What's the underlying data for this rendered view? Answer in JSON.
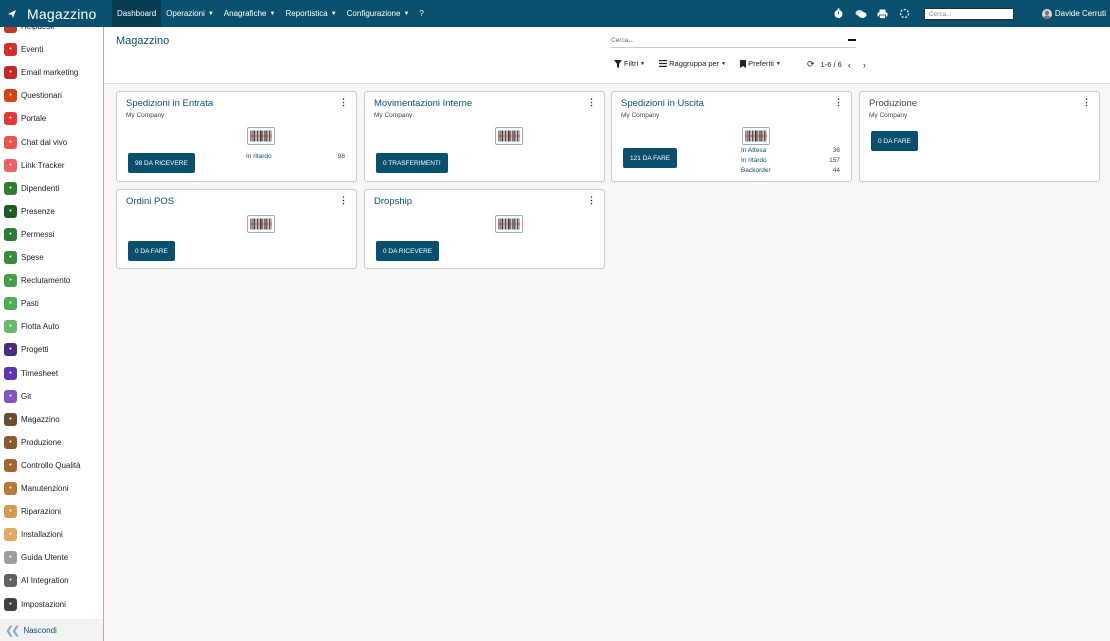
{
  "app": {
    "title": "Magazzino",
    "menu": [
      {
        "label": "Dashboard",
        "active": true,
        "dropdown": false
      },
      {
        "label": "Operazioni",
        "active": false,
        "dropdown": true
      },
      {
        "label": "Anagrafiche",
        "active": false,
        "dropdown": true
      },
      {
        "label": "Reportistica",
        "active": false,
        "dropdown": true
      },
      {
        "label": "Configurazione",
        "active": false,
        "dropdown": true
      },
      {
        "label": "?",
        "active": false,
        "dropdown": false
      }
    ],
    "search_placeholder": "Cerca...",
    "user_name": "Davide Cerruti"
  },
  "sidebar": {
    "items": [
      {
        "label": "Helpdesk",
        "color": "#c0392b",
        "icon": "helpdesk-icon"
      },
      {
        "label": "Eventi",
        "color": "#d32f2f",
        "icon": "events-icon"
      },
      {
        "label": "Email marketing",
        "color": "#c62828",
        "icon": "email-marketing-icon"
      },
      {
        "label": "Questionari",
        "color": "#d84315",
        "icon": "survey-icon"
      },
      {
        "label": "Portale",
        "color": "#e53935",
        "icon": "portal-icon"
      },
      {
        "label": "Chat dal vivo",
        "color": "#ef5350",
        "icon": "live-chat-icon"
      },
      {
        "label": "Link Tracker",
        "color": "#f06060",
        "icon": "link-tracker-icon"
      },
      {
        "label": "Dipendenti",
        "color": "#2e7d32",
        "icon": "employees-icon"
      },
      {
        "label": "Presenze",
        "color": "#1b5e20",
        "icon": "attendance-icon"
      },
      {
        "label": "Permessi",
        "color": "#2e7d32",
        "icon": "time-off-icon"
      },
      {
        "label": "Spese",
        "color": "#388e3c",
        "icon": "expenses-icon"
      },
      {
        "label": "Reclutamento",
        "color": "#43a047",
        "icon": "recruitment-icon"
      },
      {
        "label": "Pasti",
        "color": "#4caf50",
        "icon": "lunch-icon"
      },
      {
        "label": "Flotta Auto",
        "color": "#66bb6a",
        "icon": "fleet-icon"
      },
      {
        "label": "Progetti",
        "color": "#4a2c83",
        "icon": "project-icon"
      },
      {
        "label": "Timesheet",
        "color": "#5e35b1",
        "icon": "timesheet-icon"
      },
      {
        "label": "Git",
        "color": "#7e57c2",
        "icon": "git-icon"
      },
      {
        "label": "Magazzino",
        "color": "#6d4c2f",
        "icon": "inventory-icon"
      },
      {
        "label": "Produzione",
        "color": "#8d5a2b",
        "icon": "manufacturing-icon"
      },
      {
        "label": "Controllo Qualità",
        "color": "#a0662e",
        "icon": "quality-icon"
      },
      {
        "label": "Manutenzioni",
        "color": "#b8793a",
        "icon": "maintenance-icon"
      },
      {
        "label": "Riparazioni",
        "color": "#d49a52",
        "icon": "repair-icon"
      },
      {
        "label": "Installazioni",
        "color": "#e0a860",
        "icon": "installation-icon"
      },
      {
        "label": "Guida Utente",
        "color": "#9e9e9e",
        "icon": "user-guide-icon"
      },
      {
        "label": "AI Integration",
        "color": "#616161",
        "icon": "ai-icon"
      },
      {
        "label": "Impostazioni",
        "color": "#424242",
        "icon": "settings-icon"
      }
    ],
    "hide_label": "Nascondi"
  },
  "control_panel": {
    "breadcrumb": "Magazzino",
    "search_placeholder": "Cerca...",
    "filters_label": "Filtri",
    "group_by_label": "Raggruppa per",
    "favorites_label": "Preferiti",
    "pager": "1-6 / 6"
  },
  "cards": [
    {
      "title": "Spedizioni in Entrata",
      "company": "My Company",
      "button": "98 DA RICEVERE",
      "stats": [
        {
          "label": "In ritardo",
          "value": "98"
        }
      ]
    },
    {
      "title": "Movimentazioni Interne",
      "company": "My Company",
      "button": "0 TRASFERIMENTI",
      "stats": []
    },
    {
      "title": "Spedizioni in Uscita",
      "company": "My Company",
      "button": "121 DA FARE",
      "stats": [
        {
          "label": "In Attesa",
          "value": "36"
        },
        {
          "label": "In ritardo",
          "value": "157"
        },
        {
          "label": "Backorder",
          "value": "44"
        }
      ]
    },
    {
      "title": "Produzione",
      "company": "My Company",
      "button": "0 DA FARE",
      "stats": []
    },
    {
      "title": "Ordini POS",
      "company": "",
      "button": "0 DA FARE",
      "stats": []
    },
    {
      "title": "Dropship",
      "company": "",
      "button": "0 DA RICEVERE",
      "stats": []
    }
  ],
  "colors": {
    "brand": "#09506f",
    "nav_active": "#063d55"
  }
}
